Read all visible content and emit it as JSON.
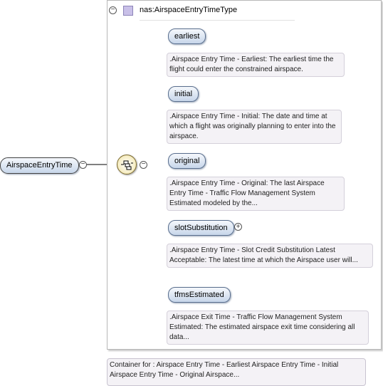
{
  "type_header": {
    "type_name": "nas:AirspaceEntryTimeType"
  },
  "root_element": {
    "label": "AirspaceEntryTime"
  },
  "children": [
    {
      "label": "earliest",
      "annotation": ".Airspace Entry Time - Earliest: The earliest time the flight could enter the constrained airspace.",
      "expandable": false
    },
    {
      "label": "initial",
      "annotation": ".Airspace Entry Time - Initial: The date and time at which a flight was originally planning to enter into the airspace.",
      "expandable": false
    },
    {
      "label": "original",
      "annotation": ".Airspace Entry Time - Original: The last Airspace Entry Time - Traffic Flow Management System Estimated modeled by the...",
      "expandable": false
    },
    {
      "label": "slotSubstitution",
      "annotation": ".Airspace Entry Time - Slot Credit Substitution Latest Acceptable: The latest time at which the Airspace user will...",
      "expandable": true
    },
    {
      "label": "tfmsEstimated",
      "annotation": ".Airspace Exit Time - Traffic Flow Management System Estimated: The estimated airspace exit time considering all data...",
      "expandable": false
    }
  ],
  "footer": {
    "text": "Container for : Airspace Entry Time - Earliest Airspace Entry Time - Initial Airspace Entry Time - Original Airspace..."
  },
  "colors": {
    "pill_fill_top": "#f5f8fc",
    "pill_fill_bottom": "#c7d6ea",
    "annotation_bg": "#f4f2f6",
    "type_icon": "#c9c0e8",
    "compositor_fill": "#f7efc9"
  }
}
